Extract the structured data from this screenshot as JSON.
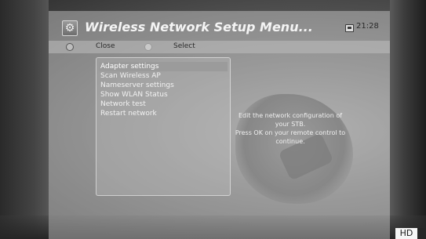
{
  "header": {
    "title": "Wireless Network Setup Menu...",
    "clock": "21:28",
    "settings_icon": "gear-icon",
    "clock_icon": "clock-icon"
  },
  "buttons": {
    "close_label": "Close",
    "select_label": "Select"
  },
  "menu": {
    "items": [
      {
        "label": "Adapter settings",
        "selected": true
      },
      {
        "label": "Scan Wireless AP",
        "selected": false
      },
      {
        "label": "Nameserver settings",
        "selected": false
      },
      {
        "label": "Show WLAN Status",
        "selected": false
      },
      {
        "label": "Network test",
        "selected": false
      },
      {
        "label": "Restart network",
        "selected": false
      }
    ]
  },
  "help": {
    "line1": "Edit the network configuration of",
    "line2": "your STB.",
    "line3": "Press OK on your remote control to",
    "line4": "continue."
  },
  "badge": {
    "hd": "HD"
  },
  "colors": {
    "selection": "#9b9b9b",
    "panel": "#ebebeb"
  }
}
